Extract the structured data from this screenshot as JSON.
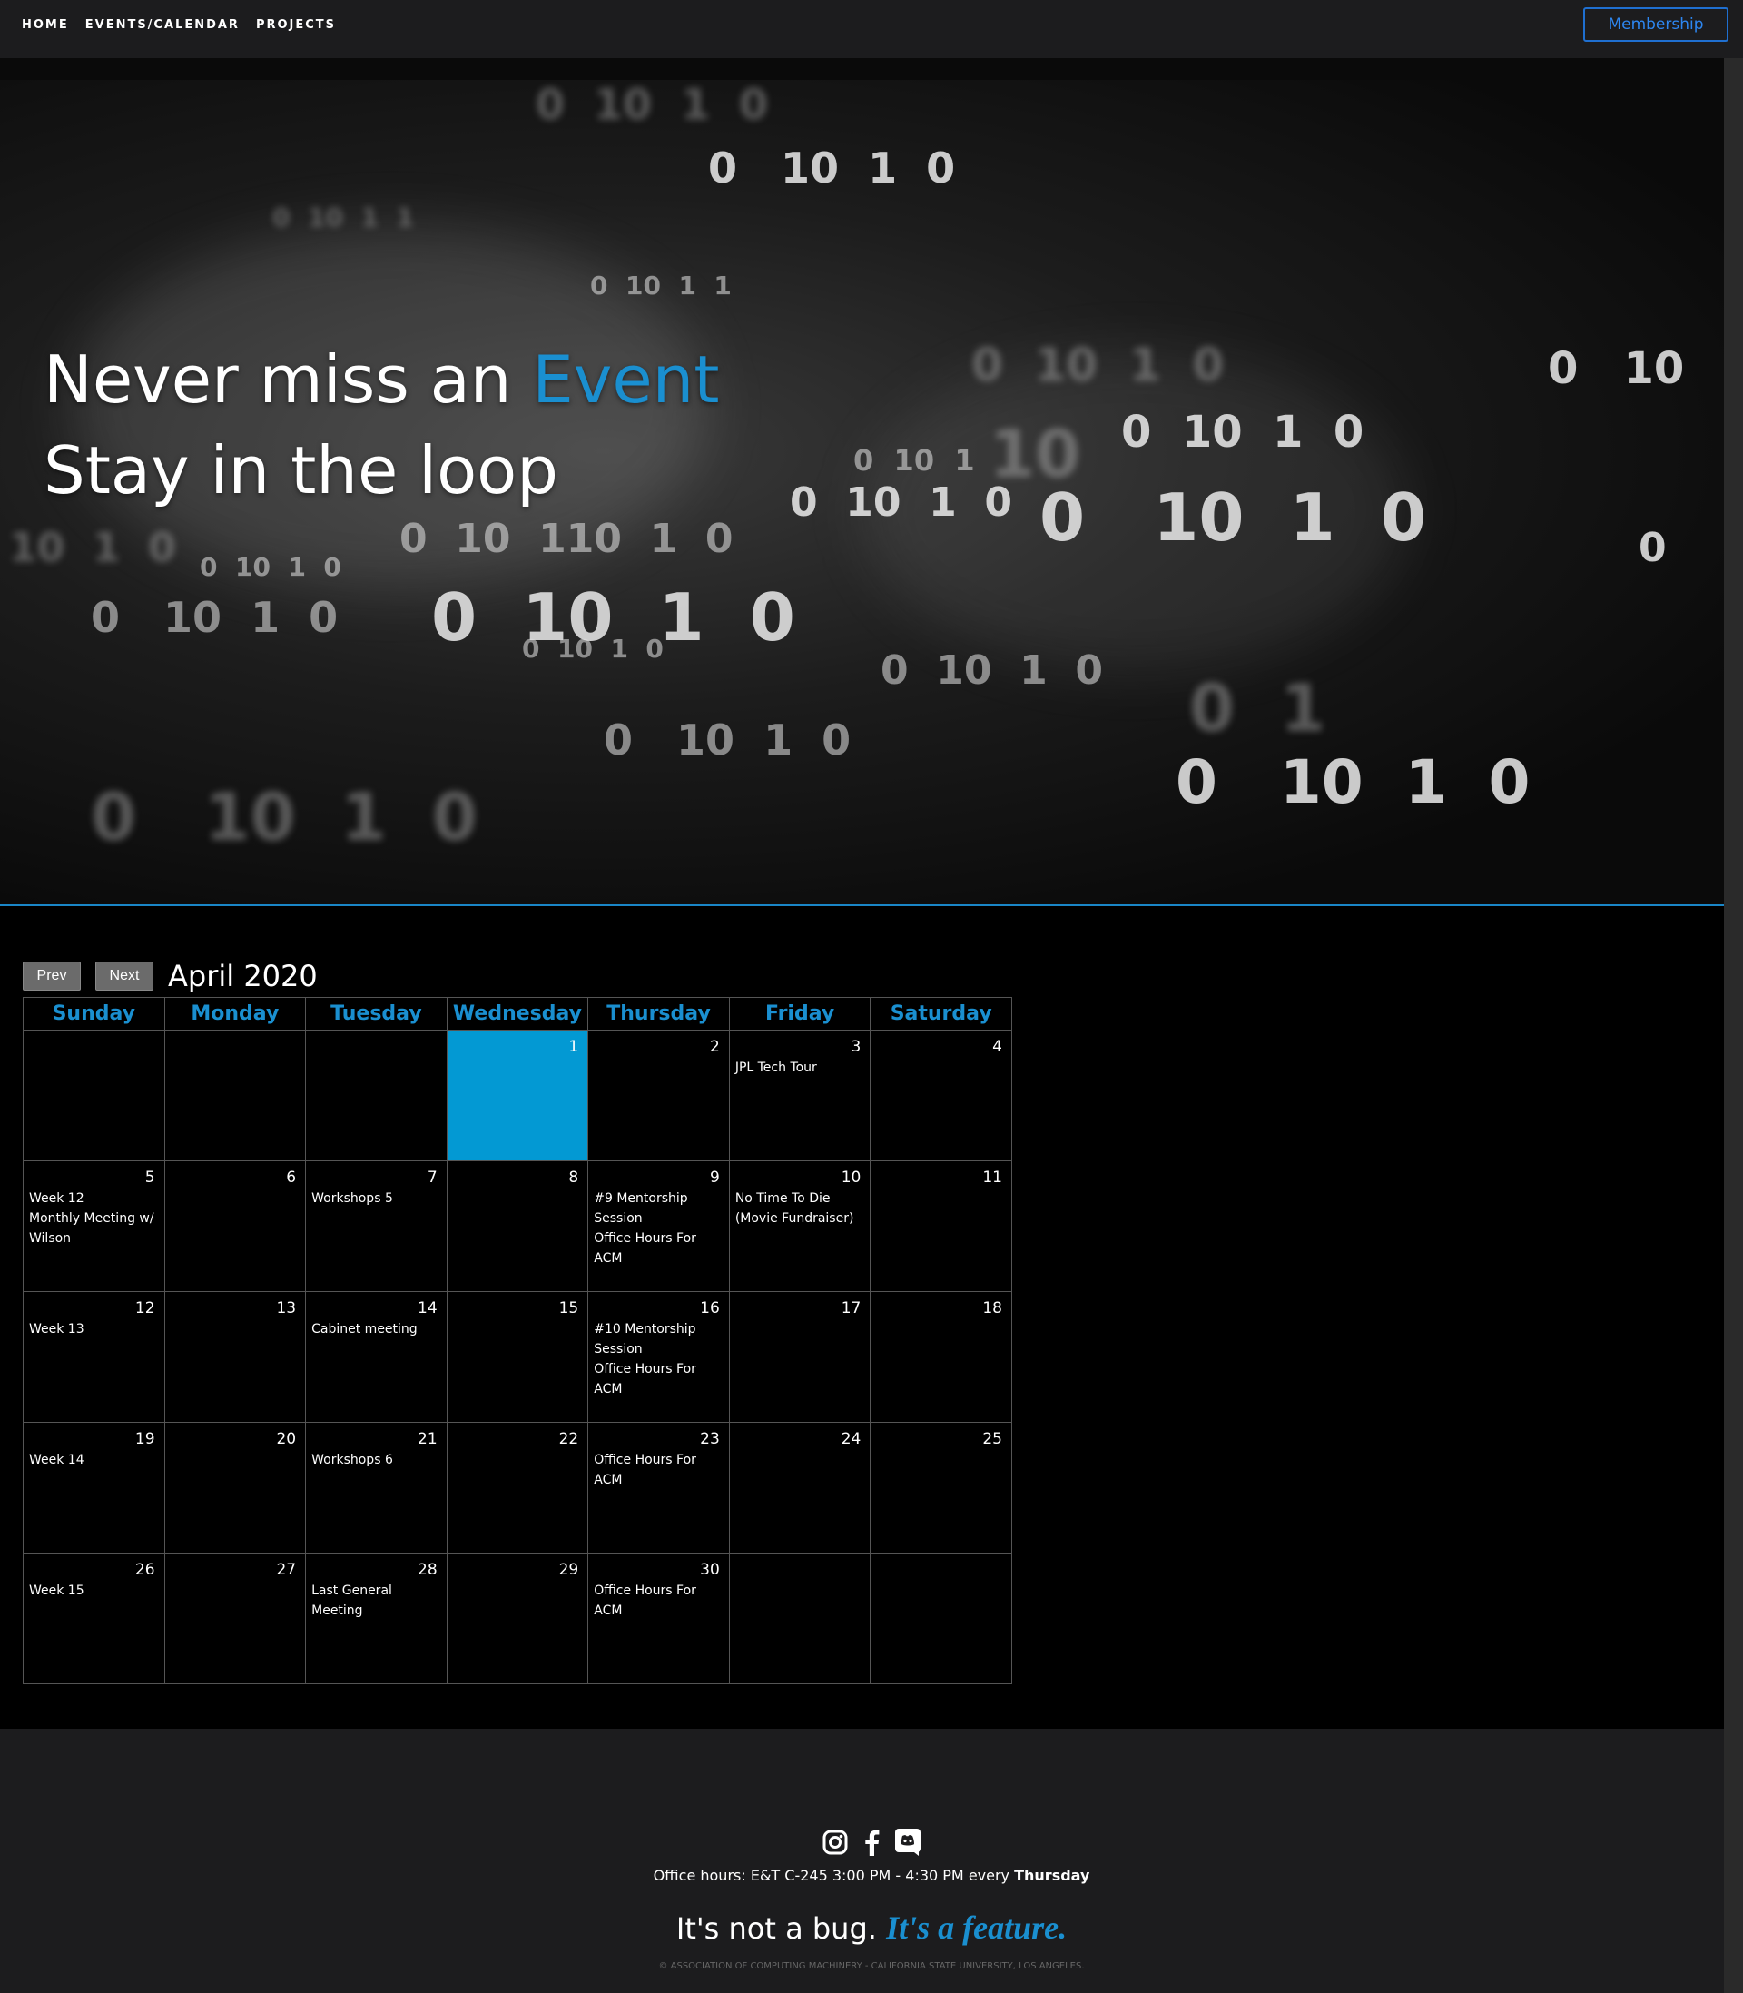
{
  "nav": {
    "links": [
      "HOME",
      "EVENTS/CALENDAR",
      "PROJECTS"
    ],
    "membership_label": "Membership"
  },
  "hero": {
    "line1_prefix": "Never miss an ",
    "line1_accent": "Event",
    "line2": "Stay in the loop",
    "accent_color": "#1a8fd0"
  },
  "calendar": {
    "prev_label": "Prev",
    "next_label": "Next",
    "month_title": "April 2020",
    "weekdays": [
      "Sunday",
      "Monday",
      "Tuesday",
      "Wednesday",
      "Thursday",
      "Friday",
      "Saturday"
    ],
    "highlight_color": "#0399d3",
    "weeks": [
      [
        {
          "day": "",
          "events": []
        },
        {
          "day": "",
          "events": []
        },
        {
          "day": "",
          "events": []
        },
        {
          "day": "1",
          "events": [],
          "today": true
        },
        {
          "day": "2",
          "events": []
        },
        {
          "day": "3",
          "events": [
            "JPL Tech Tour"
          ]
        },
        {
          "day": "4",
          "events": []
        }
      ],
      [
        {
          "day": "5",
          "events": [
            "Week 12",
            "Monthly Meeting w/ Wilson"
          ]
        },
        {
          "day": "6",
          "events": []
        },
        {
          "day": "7",
          "events": [
            "Workshops 5"
          ]
        },
        {
          "day": "8",
          "events": []
        },
        {
          "day": "9",
          "events": [
            "#9 Mentorship Session",
            "Office Hours For ACM"
          ]
        },
        {
          "day": "10",
          "events": [
            "No Time To Die (Movie Fundraiser)"
          ]
        },
        {
          "day": "11",
          "events": []
        }
      ],
      [
        {
          "day": "12",
          "events": [
            "Week 13"
          ]
        },
        {
          "day": "13",
          "events": []
        },
        {
          "day": "14",
          "events": [
            "Cabinet meeting"
          ]
        },
        {
          "day": "15",
          "events": []
        },
        {
          "day": "16",
          "events": [
            "#10 Mentorship Session",
            "Office Hours For ACM"
          ]
        },
        {
          "day": "17",
          "events": []
        },
        {
          "day": "18",
          "events": []
        }
      ],
      [
        {
          "day": "19",
          "events": [
            "Week 14"
          ]
        },
        {
          "day": "20",
          "events": []
        },
        {
          "day": "21",
          "events": [
            "Workshops 6"
          ]
        },
        {
          "day": "22",
          "events": []
        },
        {
          "day": "23",
          "events": [
            "Office Hours For ACM"
          ]
        },
        {
          "day": "24",
          "events": []
        },
        {
          "day": "25",
          "events": []
        }
      ],
      [
        {
          "day": "26",
          "events": [
            "Week 15"
          ]
        },
        {
          "day": "27",
          "events": []
        },
        {
          "day": "28",
          "events": [
            "Last General Meeting"
          ]
        },
        {
          "day": "29",
          "events": []
        },
        {
          "day": "30",
          "events": [
            "Office Hours For ACM"
          ]
        },
        {
          "day": "",
          "events": []
        },
        {
          "day": "",
          "events": []
        }
      ]
    ]
  },
  "footer": {
    "social_icons": [
      "instagram-icon",
      "facebook-icon",
      "discord-icon"
    ],
    "office_hours_prefix": "Office hours: E&T C-245 3:00 PM - 4:30 PM every ",
    "office_hours_day": "Thursday",
    "motto_plain": "It's not a bug. ",
    "motto_accent": "It's a feature.",
    "copyright": "© ASSOCIATION OF COMPUTING MACHINERY - CALIFORNIA STATE UNIVERSITY, LOS ANGELES."
  }
}
